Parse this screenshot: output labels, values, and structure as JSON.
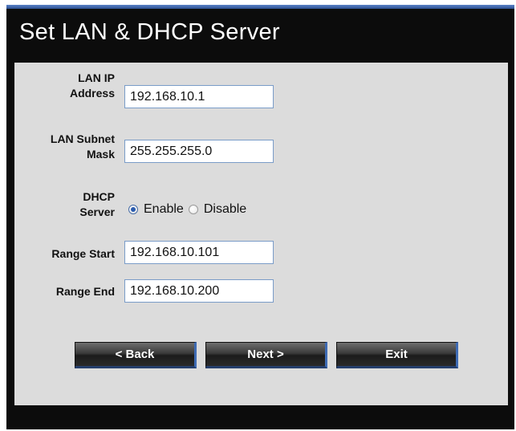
{
  "window": {
    "title": "Set LAN & DHCP Server"
  },
  "form": {
    "lan_ip": {
      "label_line1": "LAN IP",
      "label_line2": "Address",
      "value": "192.168.10.1"
    },
    "subnet_mask": {
      "label_line1": "LAN Subnet",
      "label_line2": "Mask",
      "value": "255.255.255.0"
    },
    "dhcp_server": {
      "label_line1": "DHCP",
      "label_line2": "Server",
      "enable_label": "Enable",
      "disable_label": "Disable",
      "selected": "Enable"
    },
    "range_start": {
      "label": "Range Start",
      "value": "192.168.10.101"
    },
    "range_end": {
      "label": "Range End",
      "value": "192.168.10.200"
    }
  },
  "buttons": {
    "back_label": "< Back",
    "next_label": "Next >",
    "exit_label": "Exit"
  },
  "colors": {
    "frame_background": "#0c0c0c",
    "panel_background": "#dcdcdc",
    "accent_blue": "#3e6bb4"
  }
}
